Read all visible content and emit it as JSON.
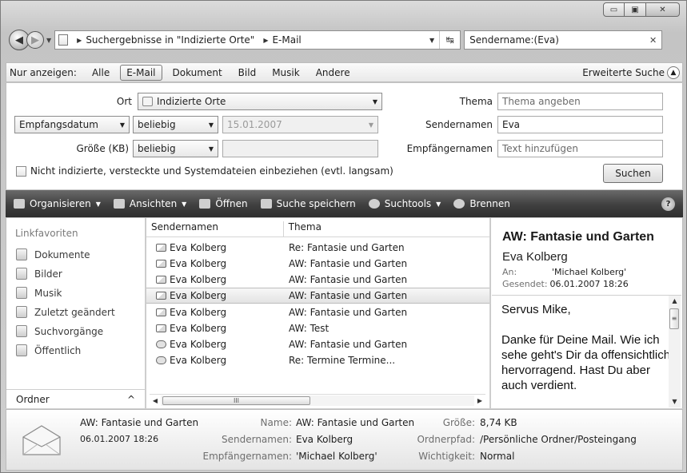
{
  "window": {
    "minimize": "▭",
    "maximize": "▣",
    "close": "✕"
  },
  "address": {
    "crumbs": [
      "Suchergebnisse in \"Indizierte Orte\"",
      "E-Mail"
    ],
    "search_value": "Sendername:(Eva)"
  },
  "filter": {
    "label": "Nur anzeigen:",
    "items": [
      "Alle",
      "E-Mail",
      "Dokument",
      "Bild",
      "Musik",
      "Andere"
    ],
    "active": "E-Mail",
    "advanced": "Erweiterte Suche"
  },
  "search": {
    "ort_label": "Ort",
    "ort_value": "Indizierte Orte",
    "date_field": "Empfangsdatum",
    "date_op": "beliebig",
    "date_value": "15.01.2007",
    "size_label": "Größe (KB)",
    "size_op": "beliebig",
    "size_value": "",
    "thema_label": "Thema",
    "thema_placeholder": "Thema angeben",
    "sender_label": "Sendernamen",
    "sender_value": "Eva",
    "recipient_label": "Empfängernamen",
    "recipient_placeholder": "Text hinzufügen",
    "checkbox_label": "Nicht indizierte, versteckte und Systemdateien einbeziehen (evtl. langsam)",
    "search_button": "Suchen"
  },
  "toolbar": {
    "organize": "Organisieren",
    "views": "Ansichten",
    "open": "Öffnen",
    "save_search": "Suche speichern",
    "search_tools": "Suchtools",
    "burn": "Brennen",
    "help": "?"
  },
  "nav": {
    "heading": "Linkfavoriten",
    "items": [
      "Dokumente",
      "Bilder",
      "Musik",
      "Zuletzt geändert",
      "Suchvorgänge",
      "Öffentlich"
    ],
    "folders": "Ordner"
  },
  "list": {
    "columns": [
      "Sendernamen",
      "Thema"
    ],
    "rows": [
      {
        "sender": "Eva Kolberg",
        "subject": "Re: Fantasie und Garten"
      },
      {
        "sender": "Eva Kolberg",
        "subject": "AW: Fantasie und Garten"
      },
      {
        "sender": "Eva Kolberg",
        "subject": "AW: Fantasie und Garten"
      },
      {
        "sender": "Eva Kolberg",
        "subject": "AW: Fantasie und Garten"
      },
      {
        "sender": "Eva Kolberg",
        "subject": "AW: Fantasie und Garten"
      },
      {
        "sender": "Eva Kolberg",
        "subject": "AW: Test"
      },
      {
        "sender": "Eva Kolberg",
        "subject": "AW: Fantasie und Garten"
      },
      {
        "sender": "Eva Kolberg",
        "subject": "Re: Termine Termine..."
      }
    ],
    "scroll_grip": "III"
  },
  "preview": {
    "subject": "AW: Fantasie und Garten",
    "sender": "Eva Kolberg",
    "to_label": "An:",
    "to_value": "'Michael Kolberg'",
    "sent_label": "Gesendet:",
    "sent_value": "06.01.2007 18:26",
    "body": [
      "Servus Mike,",
      "",
      "Danke für Deine Mail. Wie ich sehe geht's Dir da offensichtlich hervorragend. Hast Du aber auch verdient."
    ]
  },
  "details": {
    "subject": "AW: Fantasie und Garten",
    "date": "06.01.2007 18:26",
    "name_label": "Name:",
    "name_value": "AW: Fantasie und Garten",
    "sender_label": "Sendernamen:",
    "sender_value": "Eva Kolberg",
    "recipient_label": "Empfängernamen:",
    "recipient_value": "'Michael Kolberg'",
    "size_label": "Größe:",
    "size_value": "8,74 KB",
    "folder_label": "Ordnerpfad:",
    "folder_value": "/Persönliche Ordner/Posteingang",
    "importance_label": "Wichtigkeit:",
    "importance_value": "Normal"
  }
}
